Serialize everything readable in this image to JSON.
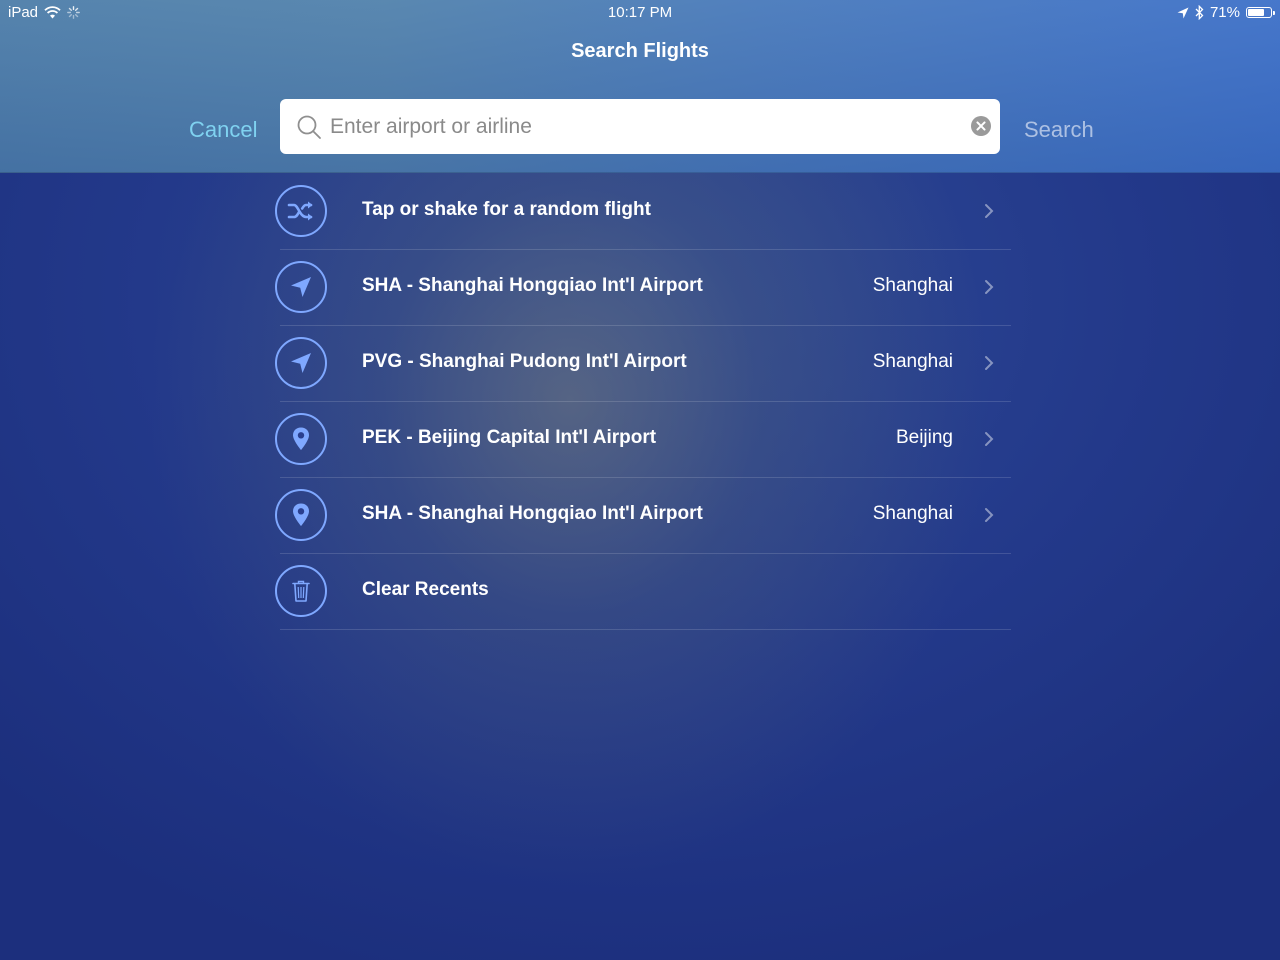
{
  "status_bar": {
    "device": "iPad",
    "time": "10:17 PM",
    "battery": "71%",
    "battery_level": 0.71
  },
  "nav": {
    "title": "Search Flights",
    "cancel_label": "Cancel",
    "search_label": "Search"
  },
  "search": {
    "placeholder": "Enter airport or airline",
    "value": ""
  },
  "list": {
    "items": [
      {
        "icon": "shuffle-icon",
        "label": "Tap or shake for a random flight",
        "city": ""
      },
      {
        "icon": "location-arrow-icon",
        "label": "SHA - Shanghai Hongqiao Int'l Airport",
        "city": "Shanghai"
      },
      {
        "icon": "location-arrow-icon",
        "label": "PVG - Shanghai Pudong Int'l Airport",
        "city": "Shanghai"
      },
      {
        "icon": "map-pin-icon",
        "label": "PEK - Beijing Capital Int'l Airport",
        "city": "Beijing"
      },
      {
        "icon": "map-pin-icon",
        "label": "SHA - Shanghai Hongqiao Int'l Airport",
        "city": "Shanghai"
      },
      {
        "icon": "trash-icon",
        "label": "Clear Recents",
        "city": ""
      }
    ]
  },
  "colors": {
    "accent": "#7fd2f0",
    "icon_ring": "#7fa8ff"
  }
}
